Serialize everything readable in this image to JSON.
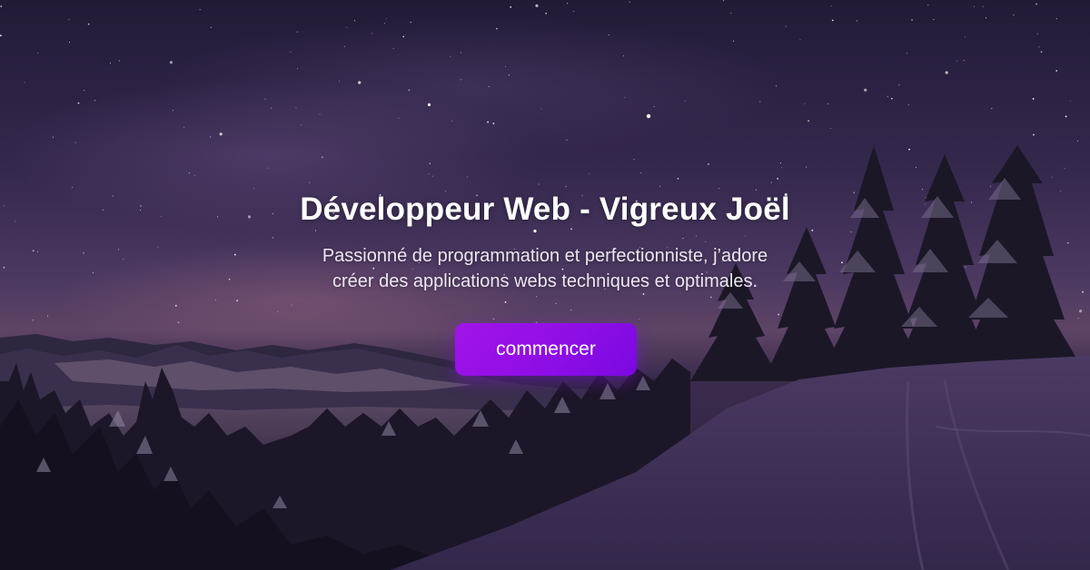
{
  "hero": {
    "title": "Développeur Web - Vigreux Joël",
    "subtitle_line1": "Passionné de programmation et perfectionniste, j’adore",
    "subtitle_line2": "créer des applications webs techniques et optimales.",
    "cta_label": "commencer",
    "cta_color": "#9b12e6",
    "background_image": "night-mountain-snow-forest-image"
  }
}
